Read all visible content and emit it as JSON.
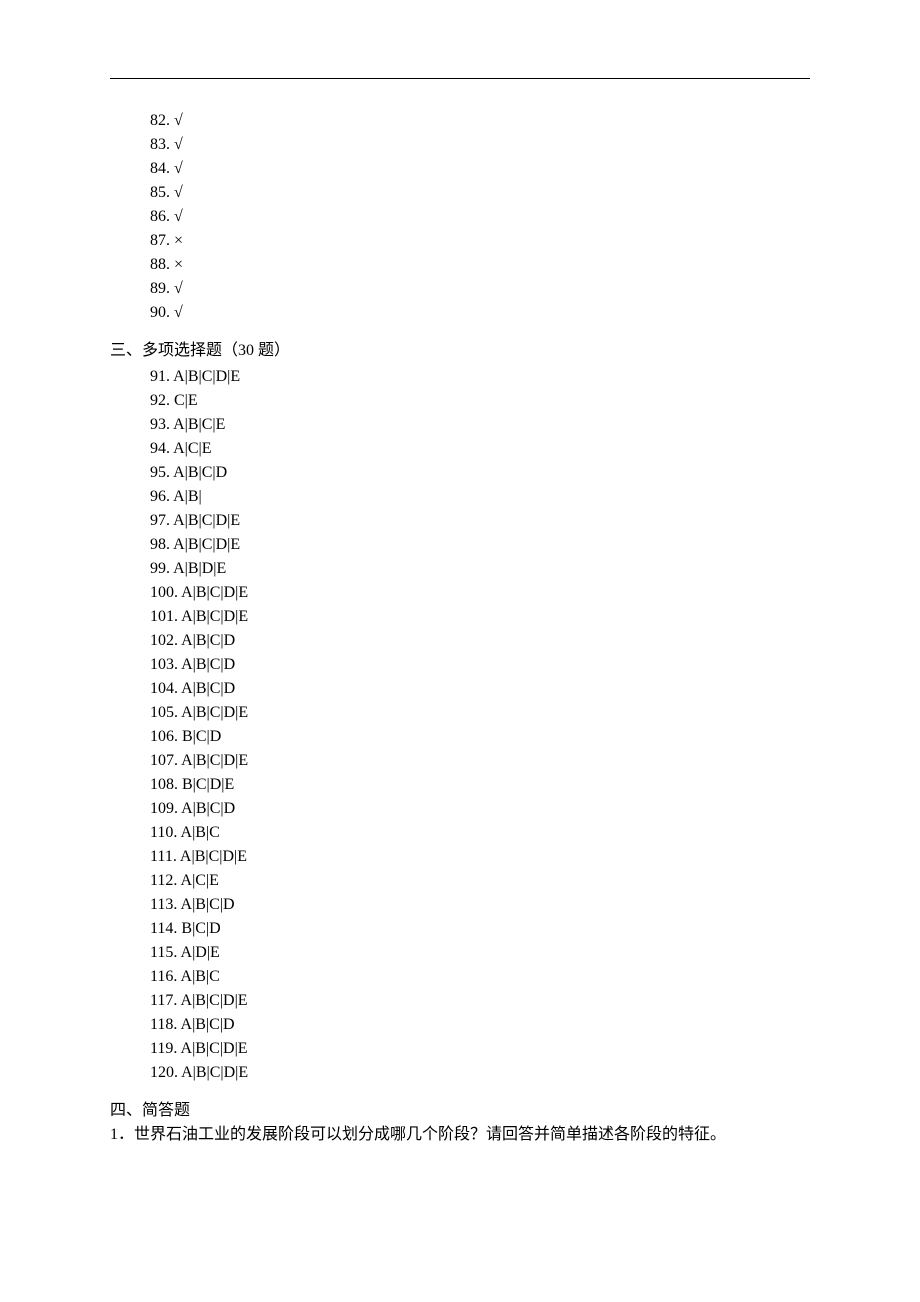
{
  "tf_answers": [
    {
      "num": "82",
      "val": "√"
    },
    {
      "num": "83",
      "val": "√"
    },
    {
      "num": "84",
      "val": "√"
    },
    {
      "num": "85",
      "val": "√"
    },
    {
      "num": "86",
      "val": "√"
    },
    {
      "num": "87",
      "val": "×"
    },
    {
      "num": "88",
      "val": "×"
    },
    {
      "num": "89",
      "val": "√"
    },
    {
      "num": "90",
      "val": "√"
    }
  ],
  "section3": {
    "title": "三、多项选择题（30 题）"
  },
  "mc_answers": [
    {
      "num": "91",
      "val": "A|B|C|D|E"
    },
    {
      "num": "92",
      "val": "C|E"
    },
    {
      "num": "93",
      "val": "A|B|C|E"
    },
    {
      "num": "94",
      "val": "A|C|E"
    },
    {
      "num": "95",
      "val": "A|B|C|D"
    },
    {
      "num": "96",
      "val": "A|B|"
    },
    {
      "num": "97",
      "val": "A|B|C|D|E"
    },
    {
      "num": "98",
      "val": "A|B|C|D|E"
    },
    {
      "num": "99",
      "val": "A|B|D|E"
    },
    {
      "num": "100",
      "val": "A|B|C|D|E"
    },
    {
      "num": "101",
      "val": "A|B|C|D|E"
    },
    {
      "num": "102",
      "val": "A|B|C|D"
    },
    {
      "num": "103",
      "val": "A|B|C|D"
    },
    {
      "num": "104",
      "val": "A|B|C|D"
    },
    {
      "num": "105",
      "val": "A|B|C|D|E"
    },
    {
      "num": "106",
      "val": "B|C|D"
    },
    {
      "num": "107",
      "val": "A|B|C|D|E"
    },
    {
      "num": "108",
      "val": "B|C|D|E"
    },
    {
      "num": "109",
      "val": "A|B|C|D"
    },
    {
      "num": "110",
      "val": "A|B|C"
    },
    {
      "num": "111",
      "val": "A|B|C|D|E"
    },
    {
      "num": "112",
      "val": "A|C|E"
    },
    {
      "num": "113",
      "val": "A|B|C|D"
    },
    {
      "num": "114",
      "val": "B|C|D"
    },
    {
      "num": "115",
      "val": "A|D|E"
    },
    {
      "num": "116",
      "val": "A|B|C"
    },
    {
      "num": "117",
      "val": "A|B|C|D|E"
    },
    {
      "num": "118",
      "val": "A|B|C|D"
    },
    {
      "num": "119",
      "val": "A|B|C|D|E"
    },
    {
      "num": "120",
      "val": "A|B|C|D|E"
    }
  ],
  "section4": {
    "title": "四、简答题",
    "q1": "1．世界石油工业的发展阶段可以划分成哪几个阶段？请回答并简单描述各阶段的特征。"
  }
}
